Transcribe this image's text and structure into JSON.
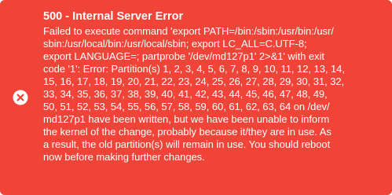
{
  "colors": {
    "background": "#f04438",
    "text": "#ffffff",
    "icon_fill": "#ffffff",
    "icon_glyph": "#f04438"
  },
  "notification": {
    "type": "error",
    "icon": "close-circle-icon",
    "title": "500 - Internal Server Error",
    "message": "Failed to execute command 'export PATH=/bin:/sbin:/usr/bin:/usr/\nsbin:/usr/local/bin:/usr/local/sbin; export LC_ALL=C.UTF-8;\nexport LANGUAGE=; partprobe '/dev/md127p1' 2>&1' with exit\ncode '1': Error: Partition(s) 1, 2, 3, 4, 5, 6, 7, 8, 9, 10, 11, 12, 13, 14,\n15, 16, 17, 18, 19, 20, 21, 22, 23, 24, 25, 26, 27, 28, 29, 30, 31, 32,\n33, 34, 35, 36, 37, 38, 39, 40, 41, 42, 43, 44, 45, 46, 47, 48, 49,\n50, 51, 52, 53, 54, 55, 56, 57, 58, 59, 60, 61, 62, 63, 64 on /dev/\nmd127p1 have been written, but we have been unable to inform\nthe kernel of the change, probably because it/they are in use. As\na result, the old partition(s) will remain in use. You should reboot\nnow before making further changes."
  }
}
